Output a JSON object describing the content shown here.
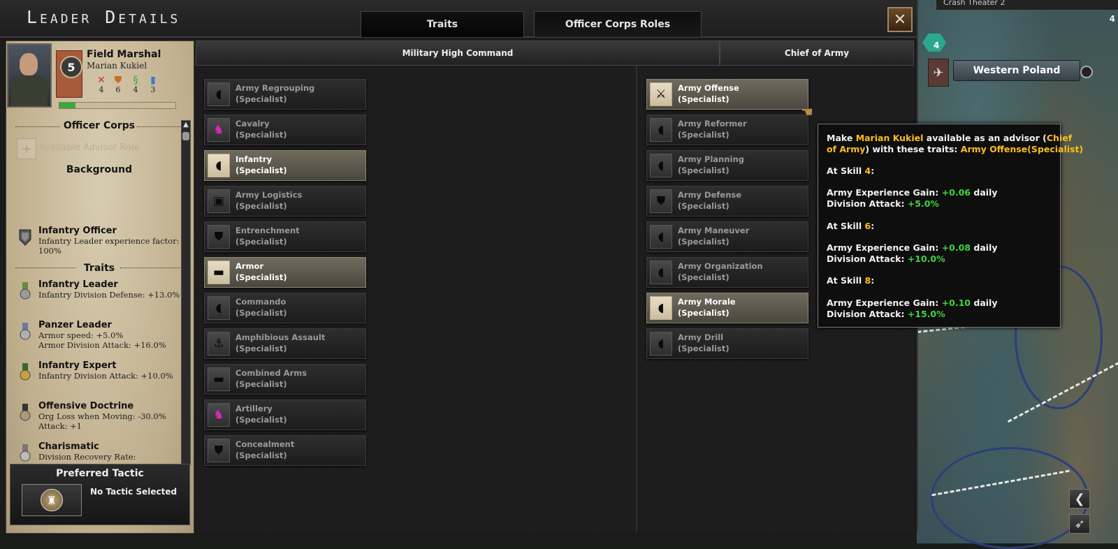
{
  "window_title": "Leader Details",
  "tabs": {
    "traits": "Traits",
    "officer_corps_roles": "Officer Corps Roles"
  },
  "close_icon": "✕",
  "leader": {
    "rank_title": "Field Marshal",
    "name": "Marian Kukiel",
    "rank_level": "5",
    "stats": [
      {
        "icon": "attack-icon",
        "glyph": "✕",
        "color": "#c83232",
        "value": "4"
      },
      {
        "icon": "defense-icon",
        "glyph": "⛊",
        "color": "#c87020",
        "value": "6"
      },
      {
        "icon": "planning-icon",
        "glyph": "§",
        "color": "#38a838",
        "value": "4"
      },
      {
        "icon": "logistics-icon",
        "glyph": "▮",
        "color": "#3c7ad0",
        "value": "3"
      }
    ],
    "xp_fraction": 0.14
  },
  "left_panel": {
    "officer_corps_heading": "Officer Corps",
    "available_advisor_role": "Available Advisor Role",
    "background_heading": "Background",
    "background_trait": {
      "name": "Infantry Officer",
      "desc": "Infantry Leader experience factor: 100%"
    },
    "traits_heading": "Traits",
    "traits": [
      {
        "name": "Infantry Leader",
        "desc": "Infantry Division Defense: +13.0%"
      },
      {
        "name": "Panzer Leader",
        "desc": "Armor speed: +5.0%\nArmor Division Attack: +16.0%"
      },
      {
        "name": "Infantry Expert",
        "desc": "Infantry Division Attack: +10.0%"
      },
      {
        "name": "Offensive Doctrine",
        "desc": "Org Loss when Moving: -30.0%\nAttack: +1"
      },
      {
        "name": "Charismatic",
        "desc": "Division Recovery Rate:"
      }
    ],
    "preferred_tactic_heading": "Preferred Tactic",
    "preferred_tactic_value": "No Tactic Selected"
  },
  "columns": {
    "military_high_command": "Military High Command",
    "chief_of_army": "Chief of Army"
  },
  "roles_high_command": [
    {
      "name": "Army Regrouping",
      "sub": "(Specialist)",
      "icon": "helmet-icon",
      "glyph": "◖",
      "selected": false
    },
    {
      "name": "Cavalry",
      "sub": "(Specialist)",
      "icon": "cavalry-icon",
      "glyph": "♞",
      "pink": true,
      "selected": false
    },
    {
      "name": "Infantry",
      "sub": "(Specialist)",
      "icon": "helmet-icon",
      "glyph": "◖",
      "selected": true
    },
    {
      "name": "Army Logistics",
      "sub": "(Specialist)",
      "icon": "logistics-crate-icon",
      "glyph": "▣",
      "selected": false
    },
    {
      "name": "Entrenchment",
      "sub": "(Specialist)",
      "icon": "shield-icon",
      "glyph": "⛊",
      "selected": false
    },
    {
      "name": "Armor",
      "sub": "(Specialist)",
      "icon": "tank-icon",
      "glyph": "▬",
      "selected": true
    },
    {
      "name": "Commando",
      "sub": "(Specialist)",
      "icon": "helmet-icon",
      "glyph": "◖",
      "selected": false
    },
    {
      "name": "Amphibious Assault",
      "sub": "(Specialist)",
      "icon": "anchor-icon",
      "glyph": "⚓",
      "selected": false
    },
    {
      "name": "Combined Arms",
      "sub": "(Specialist)",
      "icon": "tank-icon",
      "glyph": "▬",
      "selected": false
    },
    {
      "name": "Artillery",
      "sub": "(Specialist)",
      "icon": "artillery-icon",
      "glyph": "♞",
      "pink": true,
      "selected": false
    },
    {
      "name": "Concealment",
      "sub": "(Specialist)",
      "icon": "shield-icon",
      "glyph": "⛊",
      "selected": false
    }
  ],
  "roles_chief_of_army": [
    {
      "name": "Army Offense",
      "sub": "(Specialist)",
      "icon": "sword-icon",
      "glyph": "⚔",
      "selected": true
    },
    {
      "name": "Army Reformer",
      "sub": "(Specialist)",
      "icon": "helmet-icon",
      "glyph": "◖",
      "selected": false
    },
    {
      "name": "Army Planning",
      "sub": "(Specialist)",
      "icon": "helmet-icon",
      "glyph": "◖",
      "selected": false
    },
    {
      "name": "Army Defense",
      "sub": "(Specialist)",
      "icon": "shield-icon",
      "glyph": "⛊",
      "selected": false
    },
    {
      "name": "Army Maneuver",
      "sub": "(Specialist)",
      "icon": "helmet-icon",
      "glyph": "◖",
      "selected": false
    },
    {
      "name": "Army Organization",
      "sub": "(Specialist)",
      "icon": "helmet-icon",
      "glyph": "◖",
      "selected": false
    },
    {
      "name": "Army Morale",
      "sub": "(Specialist)",
      "icon": "helmet-icon",
      "glyph": "◖",
      "selected": true
    },
    {
      "name": "Army Drill",
      "sub": "(Specialist)",
      "icon": "helmet-icon",
      "glyph": "◖",
      "selected": false
    }
  ],
  "tooltip": {
    "intro_a": "Make ",
    "intro_name": "Marian Kukiel",
    "intro_b": " available as an advisor (",
    "intro_role_a": "Chief",
    "intro_role_b": "of Army",
    "intro_c": ") with these traits: ",
    "intro_trait": "Army Offense(Specialist)",
    "skill_prefix": "At Skill ",
    "skill_suffix": ":",
    "levels": [
      {
        "skill": "4",
        "xp": "+0.06",
        "attack": "+5.0%"
      },
      {
        "skill": "6",
        "xp": "+0.08",
        "attack": "+10.0%"
      },
      {
        "skill": "8",
        "xp": "+0.10",
        "attack": "+15.0%"
      }
    ],
    "xp_label": "Army Experience Gain: ",
    "xp_unit": " daily",
    "attack_label": "Division Attack: "
  },
  "map": {
    "topbar_text": "Crash Theater 2",
    "top_right_number": "4",
    "state_badge_number": "4",
    "region_name": "Western Poland"
  },
  "colors": {
    "highlight_yellow": "#ffbe1a",
    "positive_green": "#3ed43e",
    "selected_role": "#6e6b5e"
  }
}
